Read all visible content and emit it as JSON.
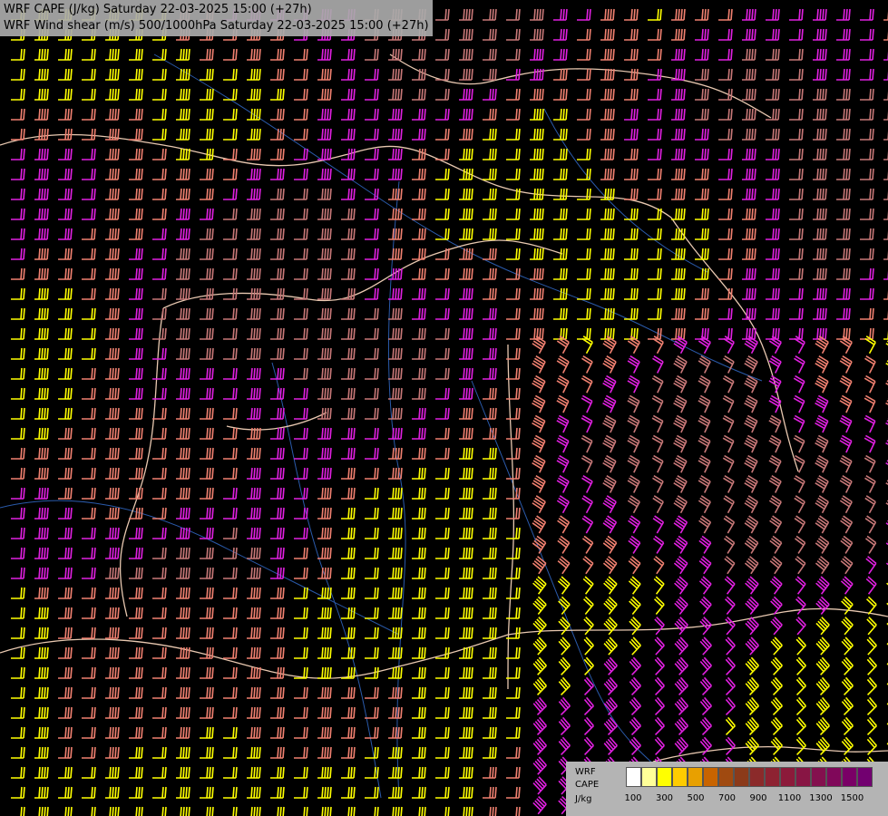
{
  "header": {
    "line1": "WRF CAPE (J/kg) Saturday 22-03-2025 15:00 (+27h)",
    "line2": "WRF Wind shear (m/s) 500/1000hPa Saturday 22-03-2025 15:00 (+27h)"
  },
  "legend": {
    "label_line1": "WRF",
    "label_line2": "CAPE",
    "label_unit": "J/kg",
    "ticks": [
      "100",
      "300",
      "500",
      "700",
      "900",
      "1100",
      "1300",
      "1500"
    ],
    "colors": [
      "#ffffff",
      "#ffff99",
      "#ffff00",
      "#ffcc00",
      "#e8a000",
      "#c86400",
      "#a04a10",
      "#8b3a1a",
      "#8b2a2a",
      "#8e2232",
      "#8c1a3a",
      "#881544",
      "#84104e",
      "#80085a",
      "#7a0066",
      "#720070"
    ]
  },
  "barb_colors": {
    "yellow": "#ffff00",
    "magenta": "#e020e0",
    "salmon": "#f08070",
    "rosy": "#c87878"
  },
  "map_colors": {
    "background": "#000000",
    "border": "#e8c8b0",
    "river": "#2a5aaa",
    "contour": "#e0e0e0"
  }
}
